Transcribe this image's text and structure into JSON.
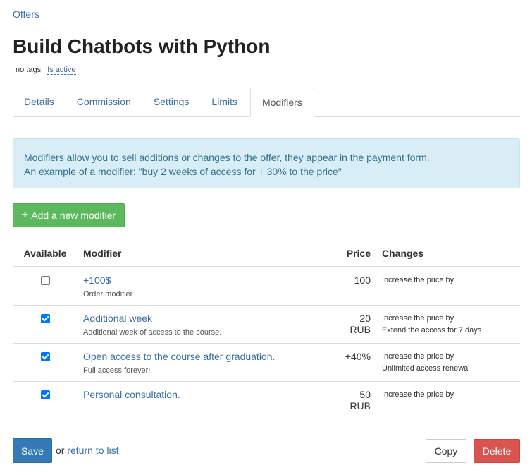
{
  "breadcrumb": "Offers",
  "title": "Build Chatbots with Python",
  "meta": {
    "tags": "no tags",
    "status": "Is active"
  },
  "tabs": [
    {
      "label": "Details",
      "active": false
    },
    {
      "label": "Commission",
      "active": false
    },
    {
      "label": "Settings",
      "active": false
    },
    {
      "label": "Limits",
      "active": false
    },
    {
      "label": "Modifiers",
      "active": true
    }
  ],
  "info": {
    "line1": "Modifiers allow you to sell additions or changes to the offer, they appear in the payment form.",
    "line2": "An example of a modifier: \"buy 2 weeks of access for + 30% to the price\""
  },
  "add_button": {
    "icon": "plus-icon",
    "label": "Add a new modifier"
  },
  "table": {
    "headers": {
      "available": "Available",
      "modifier": "Modifier",
      "price": "Price",
      "changes": "Changes"
    },
    "rows": [
      {
        "available": false,
        "name": "+100$",
        "description": "Order modifier",
        "price": "100",
        "changes": [
          "Increase the price by"
        ]
      },
      {
        "available": true,
        "name": "Additional week",
        "description": "Additional week of access to the course.",
        "price": "20 RUB",
        "changes": [
          "Increase the price by",
          "Extend the access for 7 days"
        ]
      },
      {
        "available": true,
        "name": "Open access to the course after graduation.",
        "description": "Full access forever!",
        "price": "+40%",
        "changes": [
          "Increase the price by",
          "Unlimited access renewal"
        ]
      },
      {
        "available": true,
        "name": "Personal consultation.",
        "description": "",
        "price": "50 RUB",
        "changes": [
          "Increase the price by"
        ]
      }
    ]
  },
  "footer": {
    "save": "Save",
    "or": "or",
    "return_link": "return to list",
    "copy": "Copy",
    "delete": "Delete"
  },
  "colors": {
    "link": "#3a6ea5",
    "success": "#5cb85c",
    "primary": "#337ab7",
    "danger": "#d9534f",
    "info_bg": "#d9edf7"
  }
}
